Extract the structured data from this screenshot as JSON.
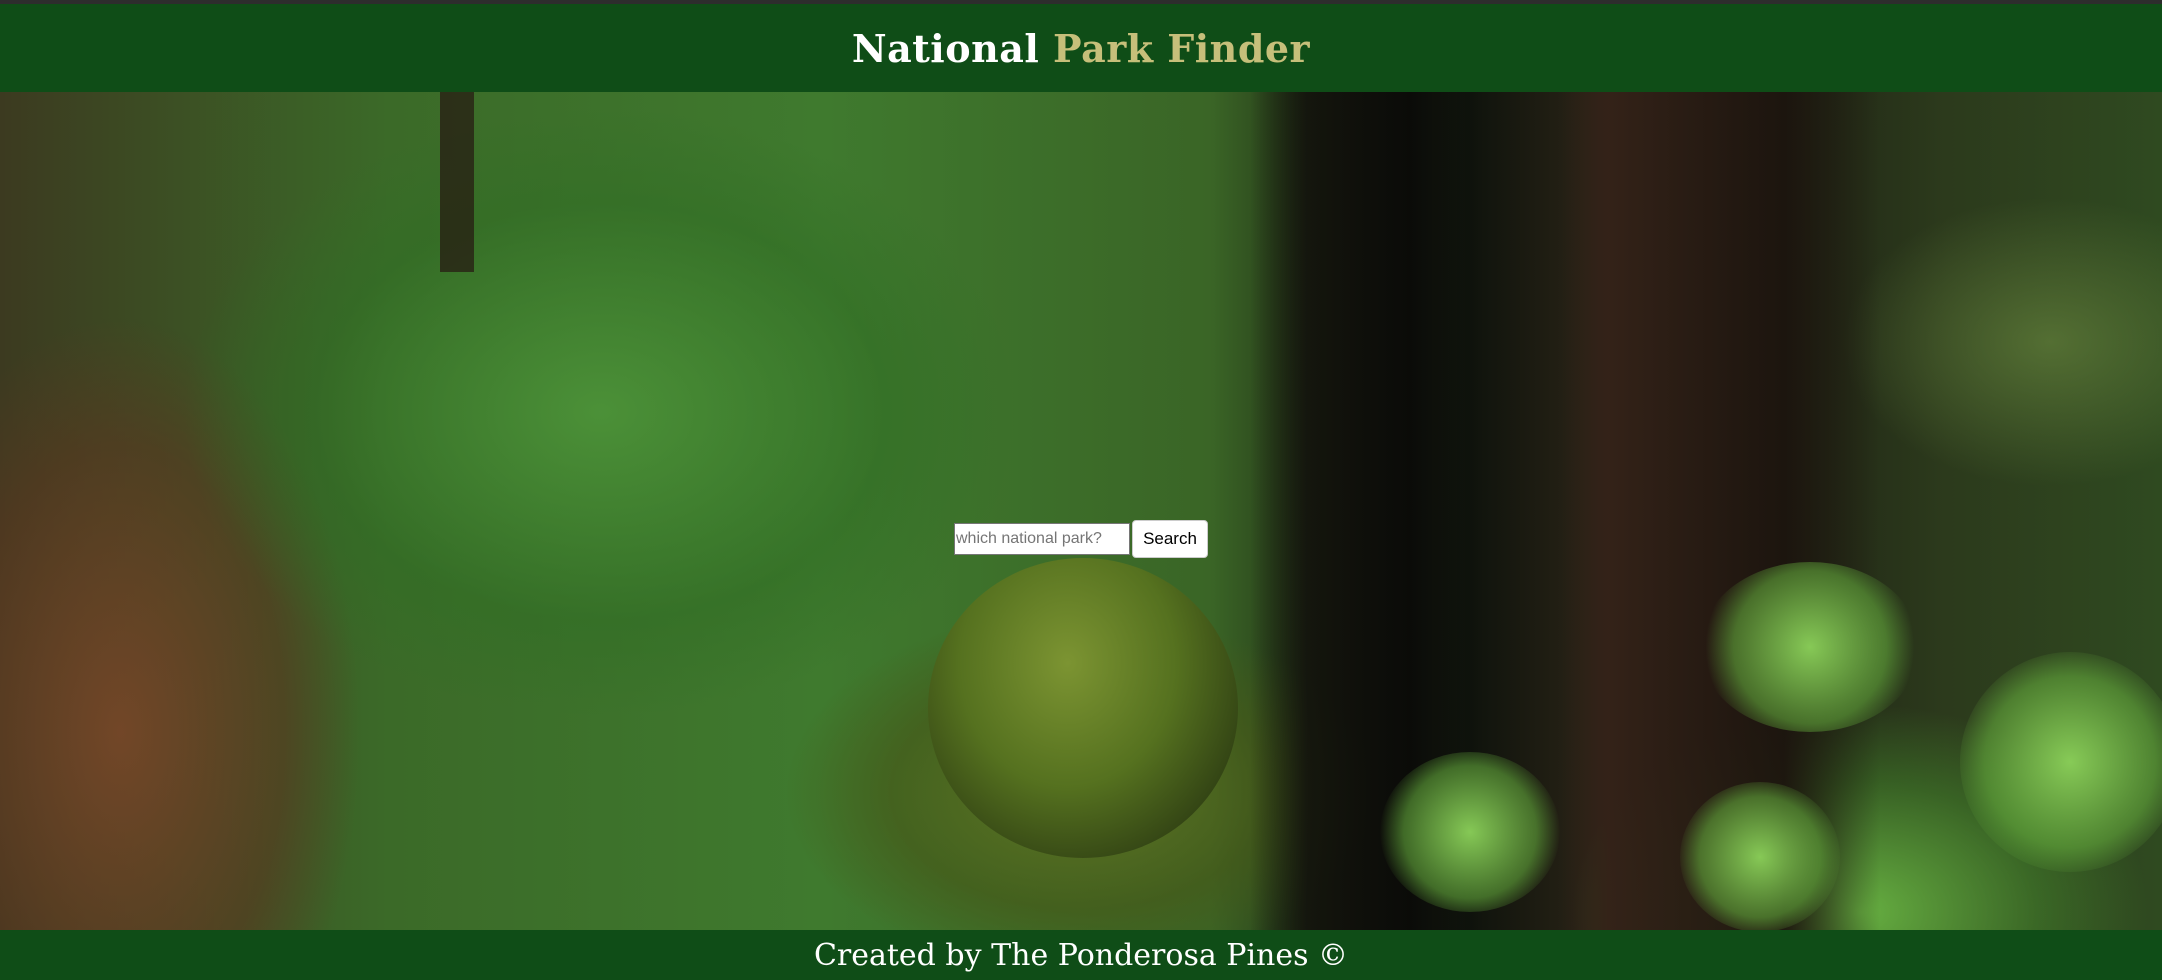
{
  "header": {
    "title_part1": "National",
    "title_part2": "Park Finder",
    "accent_color": "#c6bf7a",
    "background_color": "#0f4d17"
  },
  "search": {
    "placeholder": "which national park?",
    "value": "",
    "button_label": "Search"
  },
  "footer": {
    "text": "Created by The Ponderosa Pines ©"
  }
}
